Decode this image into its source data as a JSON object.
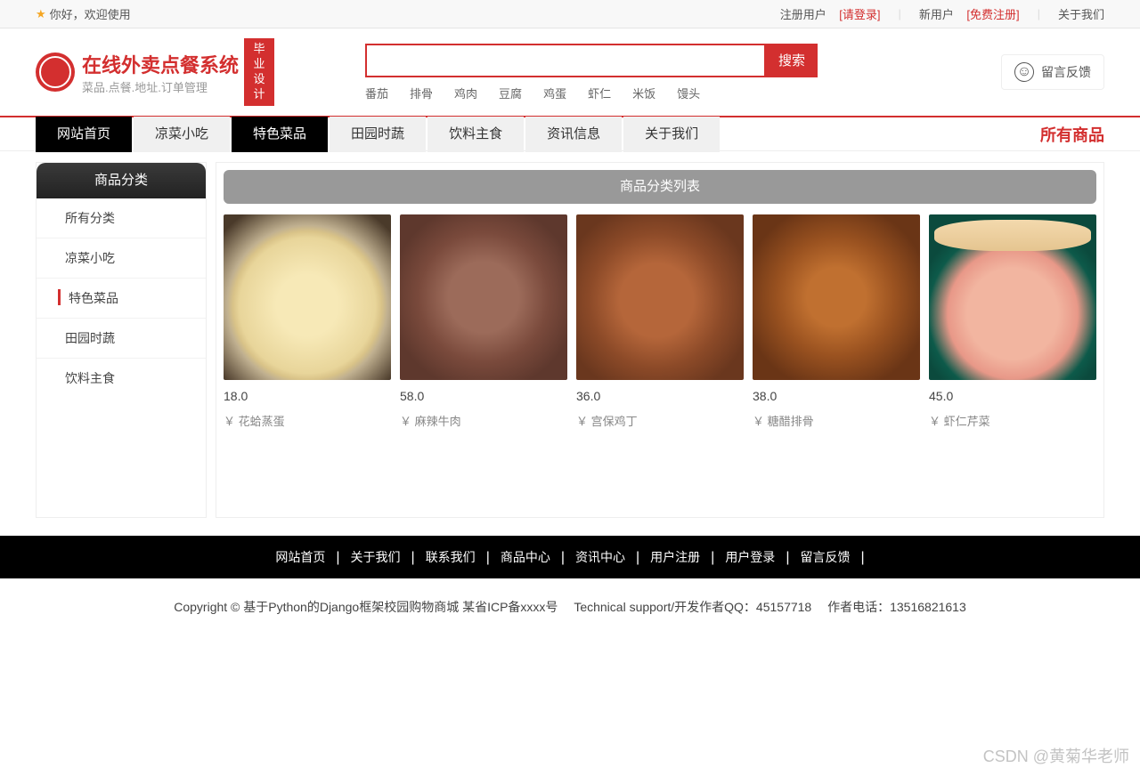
{
  "topbar": {
    "welcome": "你好，欢迎使用",
    "registered_user": "注册用户",
    "login": "[请登录]",
    "new_user": "新用户",
    "register": "[免费注册]",
    "about": "关于我们"
  },
  "logo": {
    "title": "在线外卖点餐系统",
    "subtitle": "菜品.点餐.地址.订单管理",
    "tag1": "毕业",
    "tag2": "设计"
  },
  "search": {
    "button": "搜索",
    "keywords": [
      "番茄",
      "排骨",
      "鸡肉",
      "豆腐",
      "鸡蛋",
      "虾仁",
      "米饭",
      "馒头"
    ]
  },
  "feedback_btn": "留言反馈",
  "nav": {
    "items": [
      "网站首页",
      "凉菜小吃",
      "特色菜品",
      "田园时蔬",
      "饮料主食",
      "资讯信息",
      "关于我们"
    ],
    "all_products": "所有商品"
  },
  "sidebar": {
    "header": "商品分类",
    "items": [
      "所有分类",
      "凉菜小吃",
      "特色菜品",
      "田园时蔬",
      "饮料主食"
    ]
  },
  "main": {
    "banner": "商品分类列表",
    "products": [
      {
        "price": "18.0",
        "name": "￥ 花蛤蒸蛋",
        "img_class": "egg"
      },
      {
        "price": "58.0",
        "name": "￥ 麻辣牛肉",
        "img_class": "beef"
      },
      {
        "price": "36.0",
        "name": "￥ 宫保鸡丁",
        "img_class": "gbj"
      },
      {
        "price": "38.0",
        "name": "￥ 糖醋排骨",
        "img_class": "ribs"
      },
      {
        "price": "45.0",
        "name": "￥ 虾仁芹菜",
        "img_class": "shrimp"
      }
    ]
  },
  "footer": {
    "links": [
      "网站首页",
      "关于我们",
      "联系我们",
      "商品中心",
      "资讯中心",
      "用户注册",
      "用户登录",
      "留言反馈"
    ]
  },
  "copyright": {
    "line": "Copyright © 基于Python的Django框架校园购物商城 某省ICP备xxxx号　 Technical support/开发作者QQ：45157718　 作者电话：13516821613"
  },
  "watermark": "CSDN @黄菊华老师"
}
